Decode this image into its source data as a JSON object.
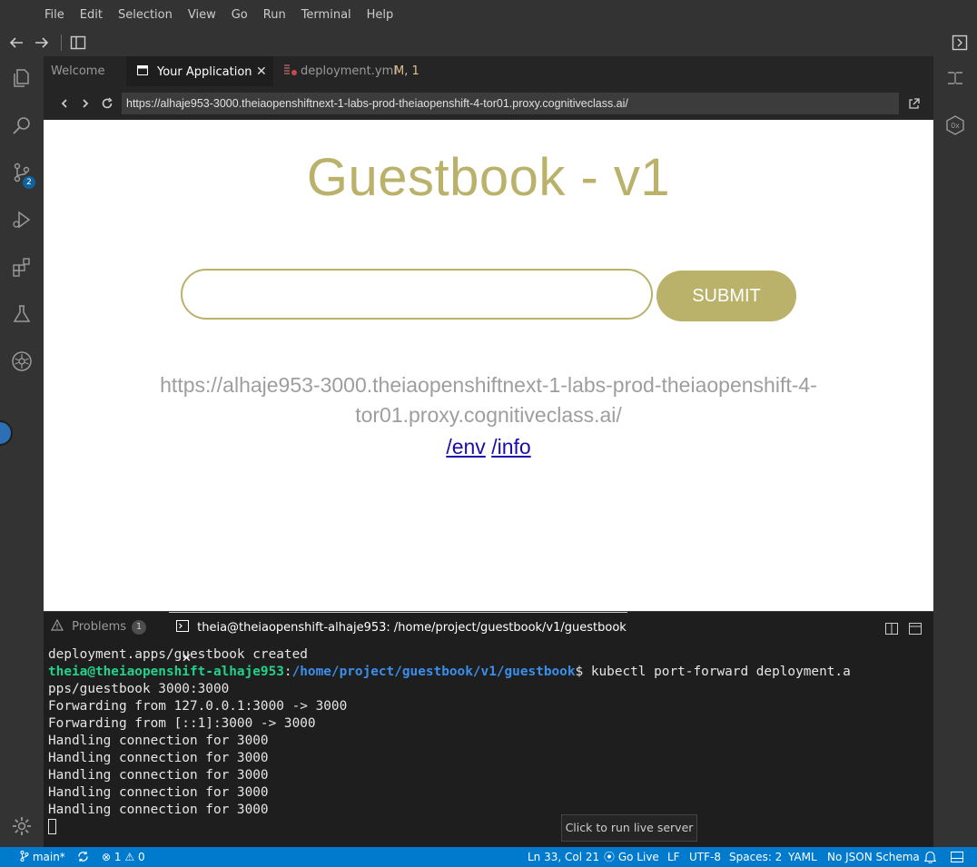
{
  "menu": [
    "File",
    "Edit",
    "Selection",
    "View",
    "Go",
    "Run",
    "Terminal",
    "Help"
  ],
  "activity": {
    "scm_badge": "2"
  },
  "tabs": [
    {
      "label": "Welcome"
    },
    {
      "label": "Your Application"
    },
    {
      "label": "deployment.yml",
      "status": "M, 1"
    }
  ],
  "browser": {
    "url": "https://alhaje953-3000.theiaopenshiftnext-1-labs-prod-theiaopenshift-4-tor01.proxy.cognitiveclass.ai/"
  },
  "app": {
    "title": "Guestbook - v1",
    "submit_label": "SUBMIT",
    "host_url": "https://alhaje953-3000.theiaopenshiftnext-1-labs-prod-theiaopenshift-4-tor01.proxy.cognitiveclass.ai/",
    "env_link": "/env",
    "info_link": "/info"
  },
  "panel": {
    "problems_label": "Problems",
    "problems_count": "1",
    "terminal_title": "theia@theiaopenshift-alhaje953: /home/project/guestbook/v1/guestbook"
  },
  "terminal": {
    "line1": "deployment.apps/guestbook created",
    "prompt_user": "theia@theiaopenshift-alhaje953",
    "prompt_sep": ":",
    "prompt_path": "/home/project/guestbook/v1/guestbook",
    "prompt_cmd": "$ kubectl port-forward deployment.a",
    "line3": "pps/guestbook 3000:3000",
    "line4": "Forwarding from 127.0.0.1:3000 -> 3000",
    "line5": "Forwarding from [::1]:3000 -> 3000",
    "line6": "Handling connection for 3000",
    "line7": "Handling connection for 3000",
    "line8": "Handling connection for 3000",
    "line9": "Handling connection for 3000",
    "line10": "Handling connection for 3000"
  },
  "tooltip": "Click to run live server",
  "status": {
    "branch": "main*",
    "errors": "1",
    "warnings": "0",
    "position": "Ln 33, Col 21",
    "go_live": "Go Live",
    "eol": "LF",
    "encoding": "UTF-8",
    "indent": "Spaces: 2",
    "language": "YAML",
    "schema": "No JSON Schema"
  },
  "colors": {
    "accent": "#bab26a",
    "statusbar": "#007acc",
    "terminal_user": "#23d18b",
    "terminal_path": "#3b8eea"
  }
}
